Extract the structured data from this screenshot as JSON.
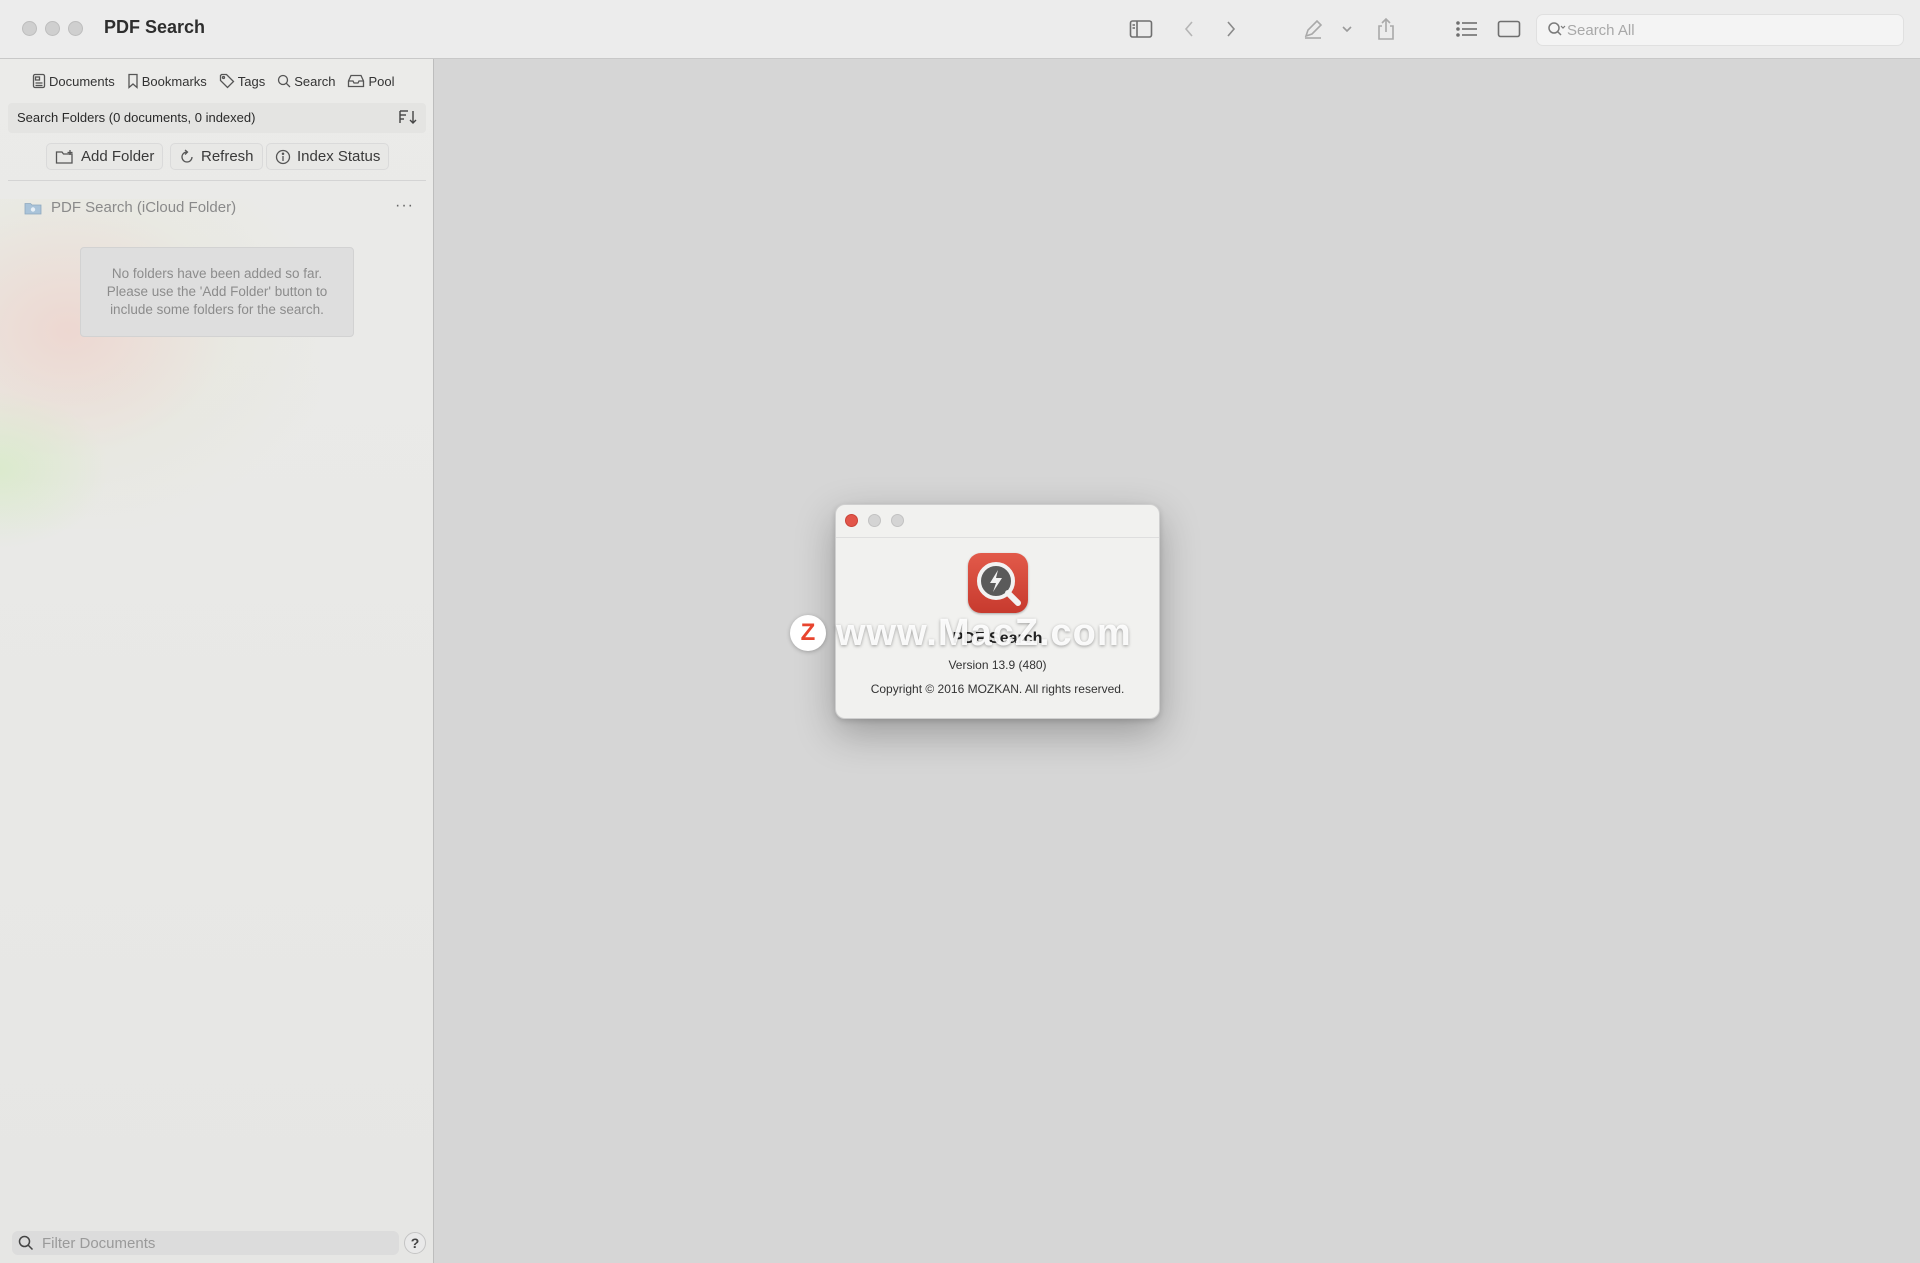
{
  "window": {
    "title": "PDF Search"
  },
  "toolbar": {
    "icons": [
      "sidebar-toggle-icon",
      "chevron-left-icon",
      "chevron-right-icon",
      "highlighter-icon",
      "chevron-down-icon",
      "share-icon",
      "list-icon",
      "page-view-icon"
    ],
    "search_placeholder": "Search All"
  },
  "sidebar": {
    "tabs": [
      {
        "label": "Documents",
        "icon": "documents-icon"
      },
      {
        "label": "Bookmarks",
        "icon": "bookmark-icon"
      },
      {
        "label": "Tags",
        "icon": "tag-icon"
      },
      {
        "label": "Search",
        "icon": "search-icon"
      },
      {
        "label": "Pool",
        "icon": "tray-icon"
      }
    ],
    "folders_header": "Search Folders (0 documents, 0 indexed)",
    "actions": {
      "add_folder": "Add Folder",
      "refresh": "Refresh",
      "index_status": "Index Status"
    },
    "cloud_folder": "PDF Search (iCloud Folder)",
    "more": "···",
    "empty_message": "No folders have been added so far. Please use the 'Add Folder' button to include some folders for the search.",
    "filter_placeholder": "Filter Documents",
    "help": "?"
  },
  "about": {
    "app_name": "PDF Search",
    "version": "Version 13.9 (480)",
    "copyright": "Copyright © 2016 MOZKAN. All rights reserved."
  },
  "watermark": {
    "logo": "Z",
    "text": "www.MacZ.com"
  },
  "colors": {
    "close": "#e2554a",
    "accent_icon": "#d4473a"
  }
}
